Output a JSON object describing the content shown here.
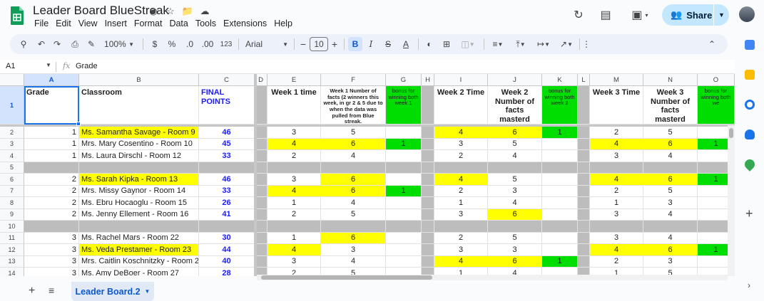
{
  "doc": {
    "title": "Leader Board BlueStreak",
    "menu": [
      "File",
      "Edit",
      "View",
      "Insert",
      "Format",
      "Data",
      "Tools",
      "Extensions",
      "Help"
    ]
  },
  "header": {
    "share_label": "Share"
  },
  "toolbar": {
    "zoom": "100%",
    "currency": "$",
    "percent": "%",
    "dec_less": ".0",
    "dec_more": ".00",
    "number_format": "123",
    "font": "Arial",
    "font_size": "10",
    "bold": "B"
  },
  "formula_bar": {
    "cell_ref": "A1",
    "fx": "fx",
    "value": "Grade"
  },
  "columns": [
    "A",
    "B",
    "C",
    "D",
    "E",
    "F",
    "G",
    "H",
    "I",
    "J",
    "K",
    "L",
    "M",
    "N",
    "O"
  ],
  "header_row": {
    "row_num": "1",
    "grade": "Grade",
    "classroom": "Classroom",
    "final_points": "FINAL POINTS",
    "week1_time": "Week 1 time",
    "week1_facts": "Week 1 Number of facts (2 winners this week, in gr 2 & 5 due to when the data was pulled from Blue streak.",
    "bonus1": "bonus for winning both week 1",
    "week2_time": "Week 2 Time",
    "week2_facts": "Week 2 Number of facts masterd",
    "bonus2": "bonus for winning both week 2",
    "week3_time": "Week 3 Time",
    "week3_facts": "Week 3 Number of facts masterd",
    "bonus3": "bonus for winning both we"
  },
  "rows": [
    {
      "num": "2",
      "grade": "1",
      "classroom": "Ms. Samantha Savage - Room 9",
      "points": "46",
      "e": "3",
      "f": "5",
      "g": "",
      "i": "4",
      "j": "6",
      "k": "1",
      "m": "2",
      "n": "5",
      "o": "",
      "sep": false
    },
    {
      "num": "3",
      "grade": "1",
      "classroom": "Mrs. Mary Cosentino - Room 10",
      "points": "45",
      "e": "4",
      "f": "6",
      "g": "1",
      "i": "3",
      "j": "5",
      "k": "",
      "m": "4",
      "n": "6",
      "o": "1",
      "sep": false
    },
    {
      "num": "4",
      "grade": "1",
      "classroom": "Ms. Laura Dirschl - Room 12",
      "points": "33",
      "e": "2",
      "f": "4",
      "g": "",
      "i": "2",
      "j": "4",
      "k": "",
      "m": "3",
      "n": "4",
      "o": "",
      "sep": false
    },
    {
      "num": "5",
      "sep": true
    },
    {
      "num": "6",
      "grade": "2",
      "classroom": "Ms. Sarah Kipka - Room 13",
      "points": "46",
      "e": "3",
      "f": "6",
      "g": "",
      "i": "4",
      "j": "5",
      "k": "",
      "m": "4",
      "n": "6",
      "o": "1",
      "sep": false
    },
    {
      "num": "7",
      "grade": "2",
      "classroom": "Mrs. Missy Gaynor - Room 14",
      "points": "33",
      "e": "4",
      "f": "6",
      "g": "1",
      "i": "2",
      "j": "3",
      "k": "",
      "m": "2",
      "n": "5",
      "o": "",
      "sep": false
    },
    {
      "num": "8",
      "grade": "2",
      "classroom": "Ms. Ebru Hocaoglu - Room 15",
      "points": "26",
      "e": "1",
      "f": "4",
      "g": "",
      "i": "1",
      "j": "4",
      "k": "",
      "m": "1",
      "n": "3",
      "o": "",
      "sep": false
    },
    {
      "num": "9",
      "grade": "2",
      "classroom": "Ms. Jenny Ellement - Room 16",
      "points": "41",
      "e": "2",
      "f": "5",
      "g": "",
      "i": "3",
      "j": "6",
      "k": "",
      "m": "3",
      "n": "4",
      "o": "",
      "sep": false
    },
    {
      "num": "10",
      "sep": true
    },
    {
      "num": "11",
      "grade": "3",
      "classroom": "Ms. Rachel Mars - Room 22",
      "points": "30",
      "e": "1",
      "f": "6",
      "g": "",
      "i": "2",
      "j": "5",
      "k": "",
      "m": "3",
      "n": "4",
      "o": "",
      "sep": false
    },
    {
      "num": "12",
      "grade": "3",
      "classroom": "Ms. Veda Prestamer - Room 23",
      "points": "44",
      "e": "4",
      "f": "3",
      "g": "",
      "i": "3",
      "j": "3",
      "k": "",
      "m": "4",
      "n": "6",
      "o": "1",
      "sep": false
    },
    {
      "num": "13",
      "grade": "3",
      "classroom": "Mrs. Caitlin Koschnitzky - Room 25",
      "points": "40",
      "e": "3",
      "f": "4",
      "g": "",
      "i": "4",
      "j": "6",
      "k": "1",
      "m": "2",
      "n": "3",
      "o": "",
      "sep": false
    },
    {
      "num": "14",
      "grade": "3",
      "classroom": "Ms. Amy DeBoer - Room 27",
      "points": "28",
      "e": "2",
      "f": "5",
      "g": "",
      "i": "1",
      "j": "4",
      "k": "",
      "m": "1",
      "n": "5",
      "o": "",
      "sep": false
    }
  ],
  "highlights": {
    "yellow": [
      "2.b",
      "2.i",
      "2.j",
      "3.e",
      "3.f",
      "3.m",
      "3.n",
      "6.b",
      "6.f",
      "6.i",
      "6.m",
      "6.n",
      "7.e",
      "7.f",
      "9.j",
      "11.f",
      "12.b",
      "12.e",
      "12.m",
      "12.n",
      "13.i",
      "13.j"
    ],
    "green": [
      "2.k",
      "3.g",
      "3.o",
      "6.o",
      "7.g",
      "12.o",
      "13.k"
    ]
  },
  "sheet_tab": {
    "label": "Leader Board.2"
  },
  "colors": {
    "highlight_yellow": "#ffff00",
    "highlight_green": "#00dd00",
    "separator_grey": "#bdbdbd",
    "points_blue": "#1a1aff",
    "share_bg": "#c2e7ff"
  }
}
